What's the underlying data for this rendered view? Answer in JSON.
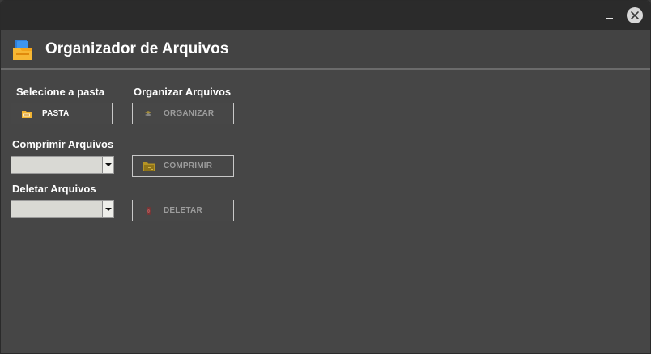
{
  "window": {
    "controls": {
      "minimize_icon": "minimize-icon",
      "close_icon": "close-icon"
    }
  },
  "header": {
    "title": "Organizador de Arquivos",
    "icon": "folder-stack-icon"
  },
  "folder_section": {
    "label": "Selecione a pasta",
    "button_label": "PASTA",
    "button_icon": "folder-icon"
  },
  "organize_section": {
    "label": "Organizar Arquivos",
    "button_label": "ORGANIZAR",
    "button_icon": "organize-icon",
    "enabled": false
  },
  "compress_section": {
    "label": "Comprimir Arquivos",
    "select_value": "",
    "button_label": "COMPRIMIR",
    "button_icon": "compress-icon",
    "enabled": false
  },
  "delete_section": {
    "label": "Deletar Arquivos",
    "select_value": "",
    "button_label": "DELETAR",
    "button_icon": "delete-icon",
    "enabled": false
  },
  "colors": {
    "background": "#464646",
    "titlebar": "#2b2b2b",
    "text": "#ffffff",
    "disabled_text": "#9c9c9c"
  }
}
